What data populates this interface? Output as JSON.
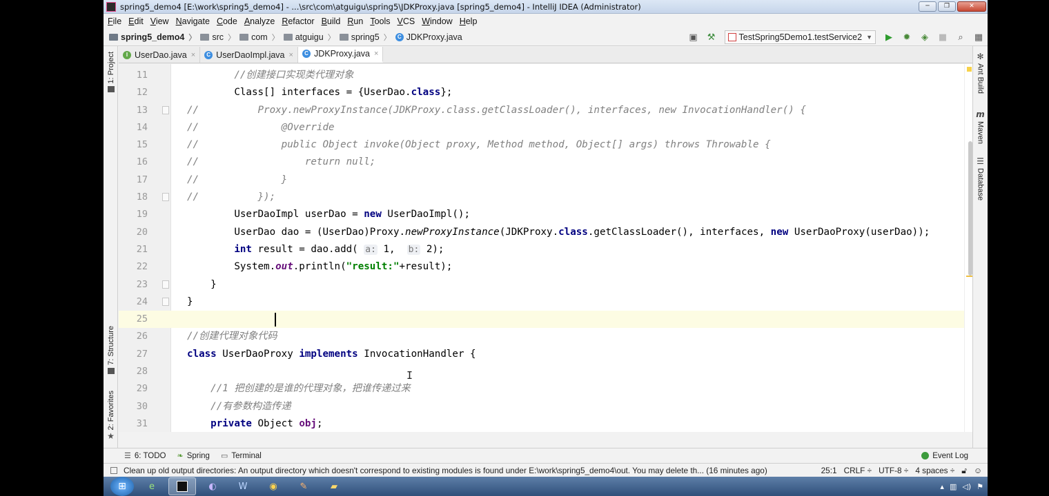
{
  "window": {
    "title": "spring5_demo4 [E:\\work\\spring5_demo4] - ...\\src\\com\\atguigu\\spring5\\JDKProxy.java [spring5_demo4] - IntelliJ IDEA (Administrator)",
    "controls": {
      "minimize": "─",
      "maximize": "❐",
      "close": "✕"
    }
  },
  "menu": [
    "File",
    "Edit",
    "View",
    "Navigate",
    "Code",
    "Analyze",
    "Refactor",
    "Build",
    "Run",
    "Tools",
    "VCS",
    "Window",
    "Help"
  ],
  "breadcrumb": [
    "spring5_demo4",
    "src",
    "com",
    "atguigu",
    "spring5",
    "JDKProxy.java"
  ],
  "run_config": "TestSpring5Demo1.testService2",
  "toolbar_icons": [
    "layout-icon",
    "build-hammer-icon",
    "run-icon",
    "debug-icon",
    "coverage-icon",
    "stop-icon",
    "search-icon",
    "project-structure-icon"
  ],
  "left_tools": {
    "project": "1: Project",
    "structure": "7: Structure",
    "favorites": "2: Favorites"
  },
  "right_tools": {
    "ant": "Ant Build",
    "maven": "Maven",
    "database": "Database"
  },
  "tabs": [
    {
      "label": "UserDao.java",
      "kind": "interface",
      "active": false
    },
    {
      "label": "UserDaoImpl.java",
      "kind": "class",
      "active": false
    },
    {
      "label": "JDKProxy.java",
      "kind": "class",
      "active": true
    }
  ],
  "editor": {
    "current_line": 25,
    "lines": [
      {
        "n": "11",
        "t": "        //创建接口实现类代理对象"
      },
      {
        "n": "12",
        "t": "        Class[] interfaces = {UserDao.class};"
      },
      {
        "n": "13",
        "t": "//          Proxy.newProxyInstance(JDKProxy.class.getClassLoader(), interfaces, new InvocationHandler() {"
      },
      {
        "n": "14",
        "t": "//              @Override"
      },
      {
        "n": "15",
        "t": "//              public Object invoke(Object proxy, Method method, Object[] args) throws Throwable {"
      },
      {
        "n": "16",
        "t": "//                  return null;"
      },
      {
        "n": "17",
        "t": "//              }"
      },
      {
        "n": "18",
        "t": "//          });"
      },
      {
        "n": "19",
        "t": "        UserDaoImpl userDao = new UserDaoImpl();"
      },
      {
        "n": "20",
        "t": "        UserDao dao = (UserDao)Proxy.newProxyInstance(JDKProxy.class.getClassLoader(), interfaces, new UserDaoProxy(userDao));"
      },
      {
        "n": "21",
        "t": "        int result = dao.add( a: 1,  b: 2);"
      },
      {
        "n": "22",
        "t": "        System.out.println(\"result:\"+result);"
      },
      {
        "n": "23",
        "t": "    }"
      },
      {
        "n": "24",
        "t": "}"
      },
      {
        "n": "25",
        "t": ""
      },
      {
        "n": "26",
        "t": "//创建代理对象代码"
      },
      {
        "n": "27",
        "t": "class UserDaoProxy implements InvocationHandler {"
      },
      {
        "n": "28",
        "t": ""
      },
      {
        "n": "29",
        "t": "    //1 把创建的是谁的代理对象，把谁传递过来"
      },
      {
        "n": "30",
        "t": "    //有参数构造传递"
      },
      {
        "n": "31",
        "t": "    private Object obj;"
      }
    ]
  },
  "bottom_tabs": {
    "todo": "6: TODO",
    "spring": "Spring",
    "terminal": "Terminal",
    "event_log": "Event Log"
  },
  "status": {
    "message": "Clean up old output directories: An output directory which doesn't correspond to existing modules is found under E:\\work\\spring5_demo4\\out. You may delete th... (16 minutes ago)",
    "position": "25:1",
    "line_sep": "CRLF ÷",
    "encoding": "UTF-8 ÷",
    "indent": "4 spaces ÷"
  },
  "taskbar": [
    "ie-icon",
    "intellij-icon",
    "eclipse-icon",
    "word-icon",
    "chrome-icon",
    "paint-icon",
    "folder-icon"
  ],
  "colors": {
    "keyword": "#000080",
    "comment": "#808080",
    "string": "#008000",
    "field": "#660e7a",
    "current_line": "#fdfce3"
  }
}
